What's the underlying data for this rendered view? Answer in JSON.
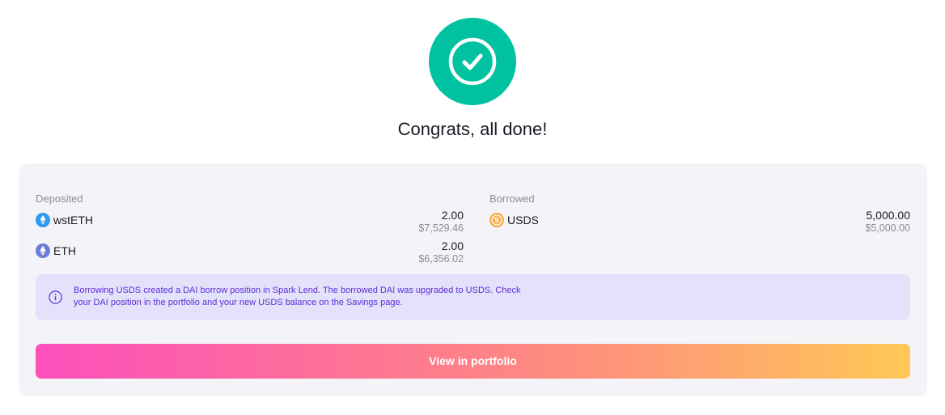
{
  "headline": "Congrats, all done!",
  "deposited": {
    "label": "Deposited",
    "items": [
      {
        "name": "wstETH",
        "amount": "2.00",
        "usd": "$7,529.46",
        "icon": "wsteth-icon"
      },
      {
        "name": "ETH",
        "amount": "2.00",
        "usd": "$6,356.02",
        "icon": "eth-icon"
      }
    ]
  },
  "borrowed": {
    "label": "Borrowed",
    "items": [
      {
        "name": "USDS",
        "amount": "5,000.00",
        "usd": "$5,000.00",
        "icon": "usds-icon"
      }
    ]
  },
  "info": {
    "text": "Borrowing USDS created a DAI borrow position in Spark Lend. The borrowed DAI was upgraded to USDS. Check your DAI position in the portfolio and your new USDS balance on the Savings page.",
    "icon": "info-icon"
  },
  "cta": {
    "label": "View in portfolio"
  },
  "colors": {
    "success": "#00c2a1",
    "info_bg": "#e4e1fb",
    "info_text": "#5b2ed6",
    "cta_gradient_start": "#fc4fbd",
    "cta_gradient_end": "#ffc955"
  }
}
